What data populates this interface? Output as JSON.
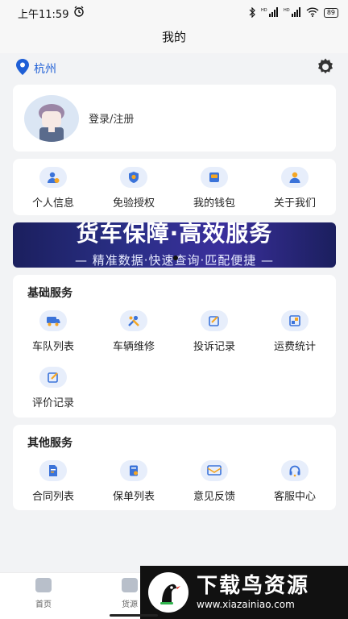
{
  "status_bar": {
    "time": "上午11:59",
    "battery": "89",
    "network_1": "HD",
    "network_2": "HD"
  },
  "header": {
    "title": "我的"
  },
  "location": {
    "city": "杭州"
  },
  "profile": {
    "login_label": "登录/注册"
  },
  "quick_actions": [
    {
      "label": "个人信息",
      "icon": "person-info-icon"
    },
    {
      "label": "免验授权",
      "icon": "shield-icon"
    },
    {
      "label": "我的钱包",
      "icon": "wallet-icon"
    },
    {
      "label": "关于我们",
      "icon": "about-us-icon"
    }
  ],
  "banner": {
    "title": "货车保障·高效服务",
    "subtitle": "— 精准数据·快速查询·匹配便捷 —"
  },
  "basic_services": {
    "title": "基础服务",
    "items": [
      {
        "label": "车队列表",
        "icon": "fleet-icon"
      },
      {
        "label": "车辆维修",
        "icon": "repair-tools-icon"
      },
      {
        "label": "投诉记录",
        "icon": "complaint-icon"
      },
      {
        "label": "运费统计",
        "icon": "freight-stats-icon"
      },
      {
        "label": "评价记录",
        "icon": "review-edit-icon"
      }
    ]
  },
  "other_services": {
    "title": "其他服务",
    "items": [
      {
        "label": "合同列表",
        "icon": "contract-icon"
      },
      {
        "label": "保单列表",
        "icon": "policy-icon"
      },
      {
        "label": "意见反馈",
        "icon": "feedback-icon"
      },
      {
        "label": "客服中心",
        "icon": "headset-icon"
      }
    ]
  },
  "tabbar": {
    "home": "首页",
    "cargo": "货源"
  },
  "watermark": {
    "title": "下载鸟资源",
    "url": "www.xiazainiao.com"
  },
  "colors": {
    "accent": "#1f5fd6",
    "icon_bg": "#e7eefb",
    "icon_blue": "#3b73d9",
    "icon_orange": "#f5a623"
  }
}
